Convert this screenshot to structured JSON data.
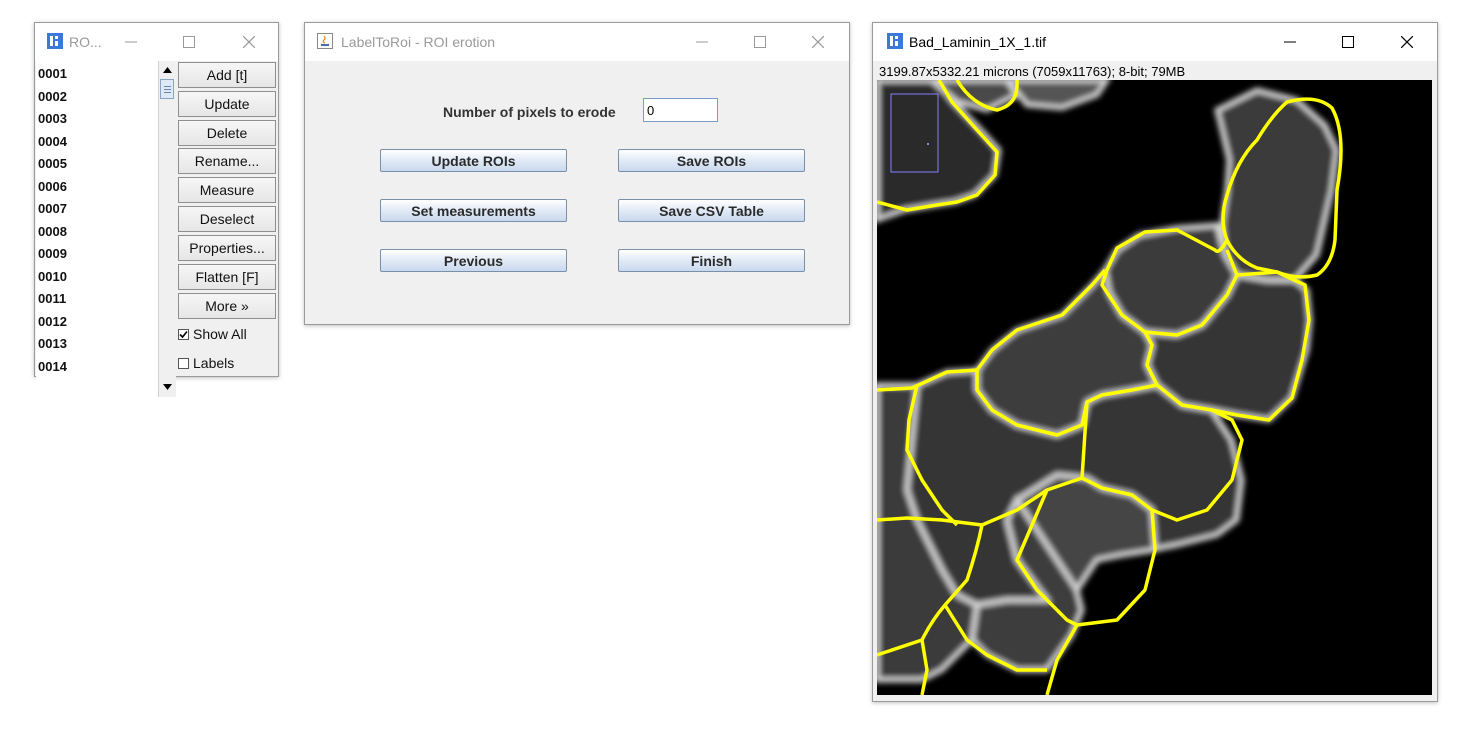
{
  "roi_manager": {
    "title": "RO...",
    "items": [
      "0001",
      "0002",
      "0003",
      "0004",
      "0005",
      "0006",
      "0007",
      "0008",
      "0009",
      "0010",
      "0011",
      "0012",
      "0013",
      "0014"
    ],
    "buttons": [
      "Add [t]",
      "Update",
      "Delete",
      "Rename...",
      "Measure",
      "Deselect",
      "Properties...",
      "Flatten [F]",
      "More »"
    ],
    "show_all_label": "Show All",
    "show_all_checked": true,
    "labels_label": "Labels",
    "labels_checked": false
  },
  "erosion_dialog": {
    "title": "LabelToRoi - ROI erotion",
    "pixels_label": "Number of pixels to erode",
    "pixels_value": "0",
    "buttons": {
      "update_rois": "Update ROIs",
      "save_rois": "Save ROIs",
      "set_measurements": "Set measurements",
      "save_csv": "Save CSV Table",
      "previous": "Previous",
      "finish": "Finish"
    }
  },
  "image_window": {
    "title": "Bad_Laminin_1X_1.tif",
    "info": "3199.87x5332.21 microns (7059x11763); 8-bit; 79MB"
  },
  "colors": {
    "roi_outline": "#ffff00",
    "selection_rect": "#8080ff",
    "image_background": "#000000"
  }
}
